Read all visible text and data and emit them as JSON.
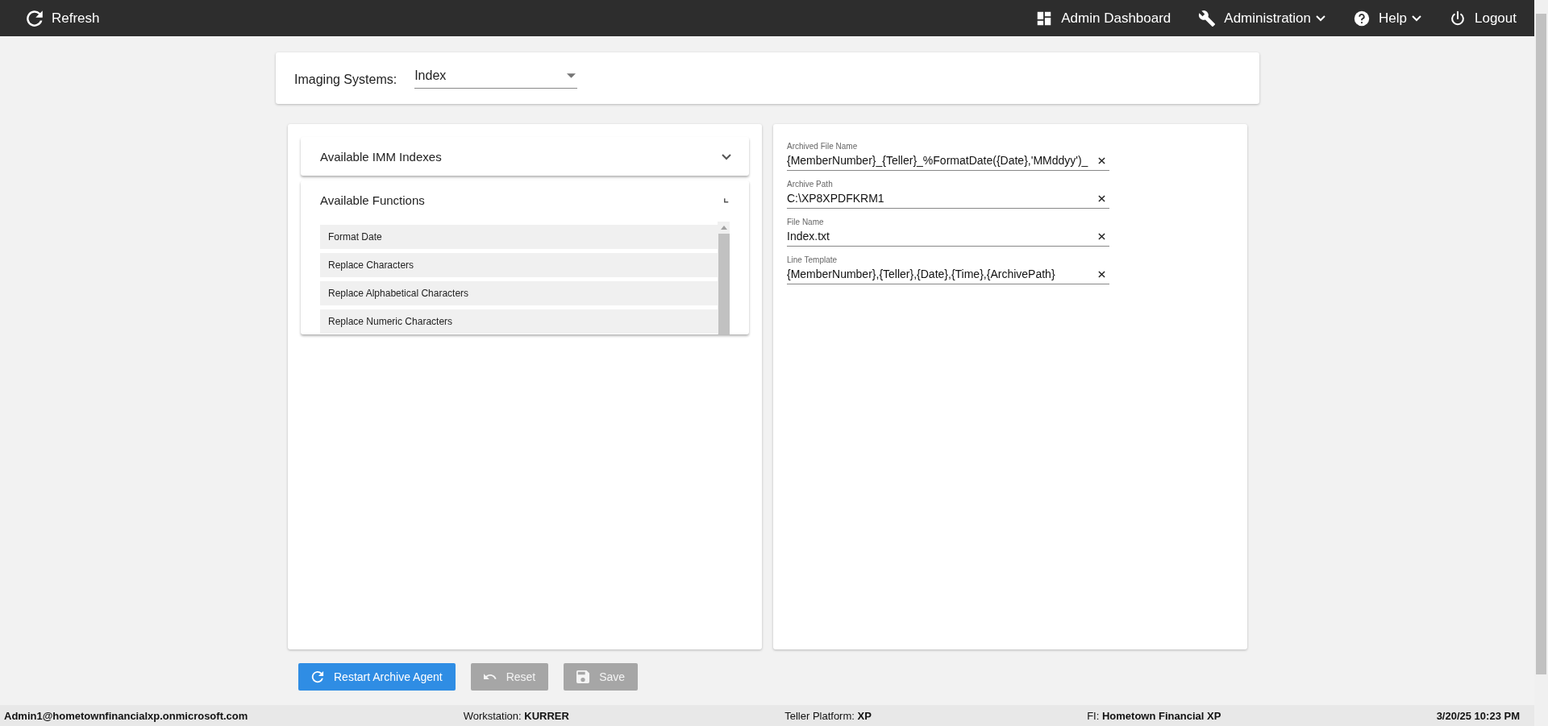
{
  "top_bar": {
    "refresh": "Refresh",
    "menu": [
      {
        "label": "Admin Dashboard",
        "dropdown": false
      },
      {
        "label": "Administration",
        "dropdown": true
      },
      {
        "label": "Help",
        "dropdown": true
      },
      {
        "label": "Logout",
        "dropdown": false
      }
    ]
  },
  "imaging_systems": {
    "label": "Imaging Systems:",
    "value": "Index"
  },
  "accordions": [
    {
      "title": "Available IMM Indexes",
      "expanded": false
    },
    {
      "title": "Available Functions",
      "expanded": true,
      "items": [
        "Format Date",
        "Replace Characters",
        "Replace Alphabetical Characters",
        "Replace Numeric Characters"
      ]
    }
  ],
  "fields": [
    {
      "label": "Archived File Name",
      "value": "{MemberNumber}_{Teller}_%FormatDate({Date},'MMddyy')_"
    },
    {
      "label": "Archive Path",
      "value": "C:\\XP8XPDFKRM1"
    },
    {
      "label": "File Name",
      "value": "Index.txt"
    },
    {
      "label": "Line Template",
      "value": "{MemberNumber},{Teller},{Date},{Time},{ArchivePath}"
    }
  ],
  "buttons": [
    {
      "label": "Restart Archive Agent",
      "disabled": false
    },
    {
      "label": "Reset",
      "disabled": true
    },
    {
      "label": "Save",
      "disabled": true
    }
  ],
  "status_bar": {
    "user": "Admin1@hometownfinancialxp.onmicrosoft.com",
    "items": [
      "Workstation: **KURRER**",
      "Teller Platform: **XP**",
      "FI: **Hometown Financial XP**"
    ],
    "time": "3/20/25 10:23 PM"
  }
}
